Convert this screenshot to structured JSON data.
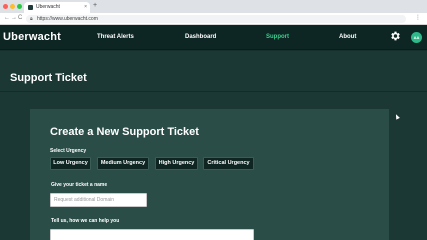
{
  "browser": {
    "tab_title": "Uberwacht",
    "tab_close": "×",
    "new_tab": "+",
    "url": "https://www.uberwacht.com",
    "nav_back": "←",
    "nav_forward": "→",
    "nav_reload": "C",
    "lock_icon": "lock-icon",
    "menu": "⋮"
  },
  "nav": {
    "brand": "Uberwacht",
    "links": [
      {
        "label": "Threat Alerts",
        "active": false
      },
      {
        "label": "Dashboard",
        "active": false
      },
      {
        "label": "Support",
        "active": true
      },
      {
        "label": "About",
        "active": false
      }
    ],
    "settings_icon": "gear-icon",
    "avatar_initials": "AA"
  },
  "page": {
    "title": "Support Ticket"
  },
  "form": {
    "title": "Create a New Support Ticket",
    "urgency_label": "Select Urgency",
    "urgency_options": [
      "Low Urgency",
      "Medium Urgency",
      "High Urgency",
      "Critical Urgency"
    ],
    "name_label": "Give your ticket a name",
    "name_placeholder": "Request additional Domain",
    "name_value": "",
    "help_label": "Tell us, how we can help you",
    "help_value": ""
  },
  "colors": {
    "accent": "#3ecf8e",
    "nav_bg": "#0e2623",
    "page_bg": "#1b3834",
    "card_bg": "#2b4d48",
    "button_bg": "#0f2522"
  }
}
